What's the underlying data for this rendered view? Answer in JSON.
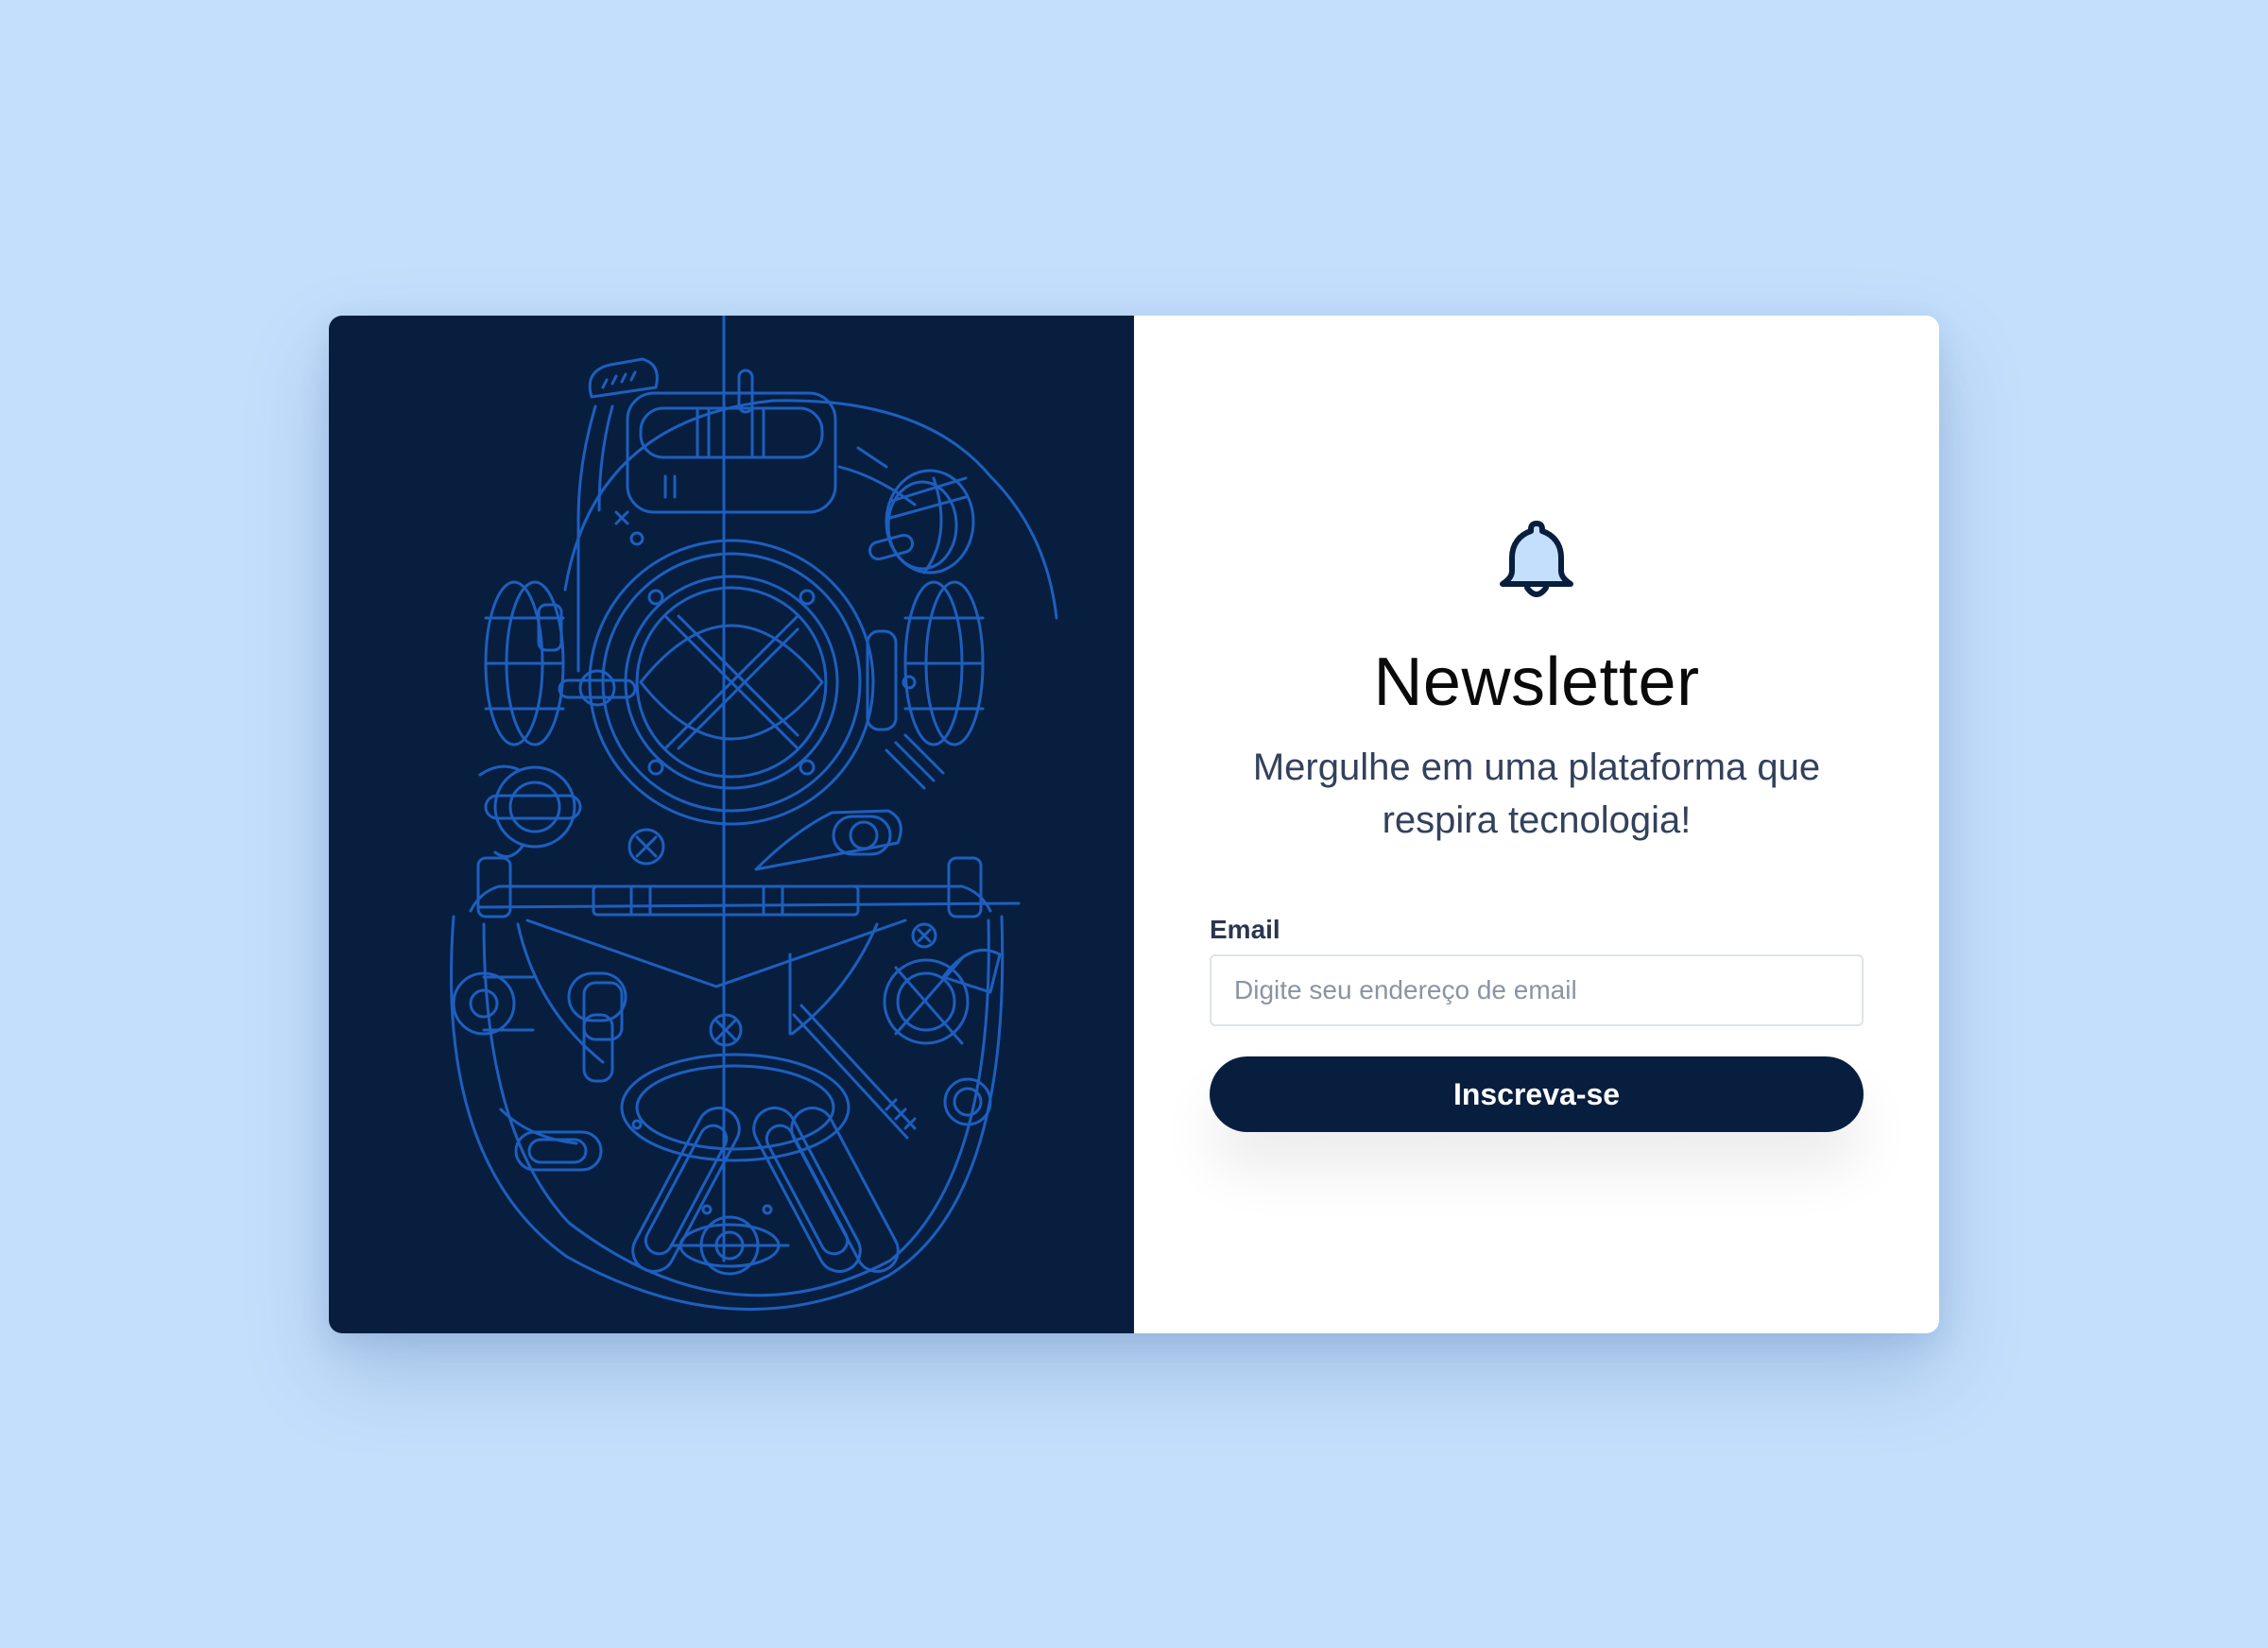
{
  "newsletter": {
    "title": "Newsletter",
    "subtitle": "Mergulhe em uma plataforma que respira tecnologia!",
    "email_label": "Email",
    "email_placeholder": "Digite seu endereço de email",
    "email_value": "",
    "submit_label": "Inscreva-se",
    "bell_icon": "bell-icon",
    "illustration": "diving-helmet-illustration"
  },
  "colors": {
    "page_background": "#c4dffc",
    "panel_dark": "#081e3e",
    "illustration_line": "#1d5fbf",
    "button_background": "#081e3e",
    "bell_fill": "#c4dffc"
  }
}
